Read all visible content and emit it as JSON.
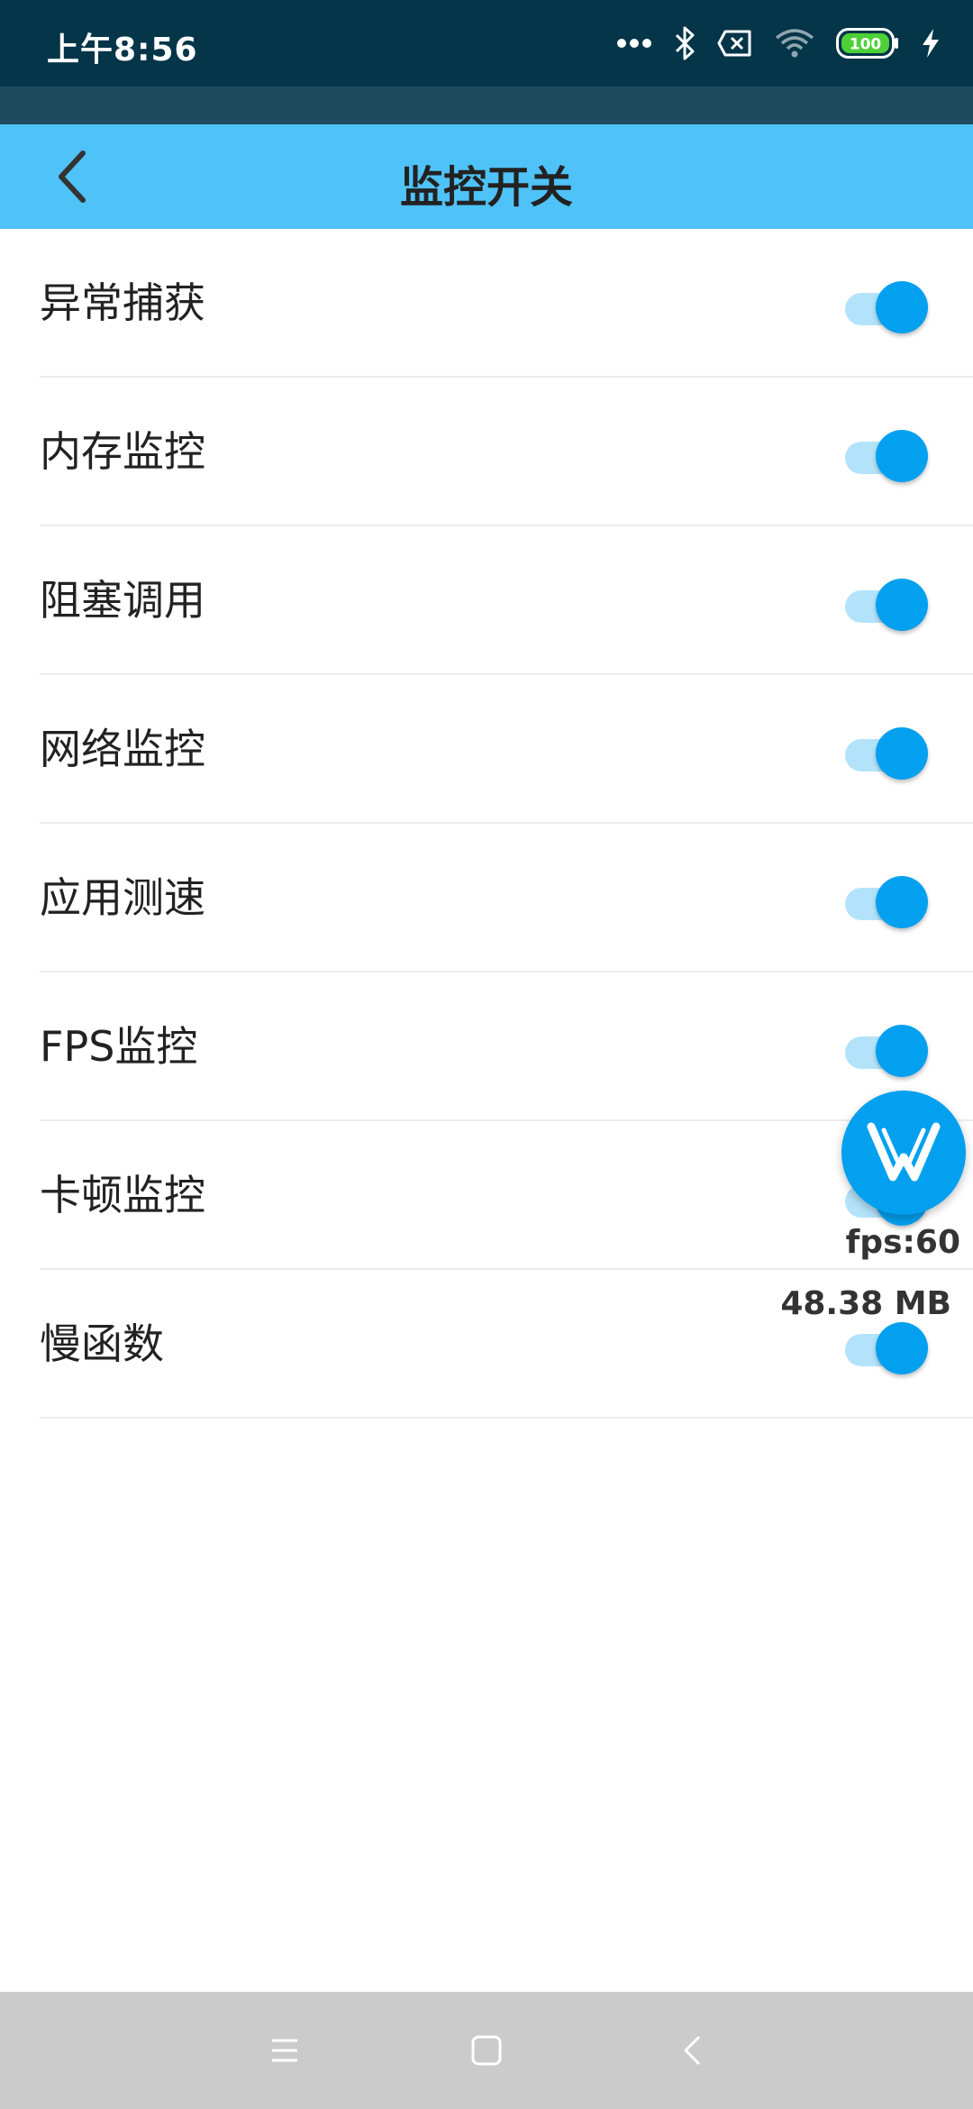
{
  "status_bar": {
    "time": "上午8:56",
    "battery_level": "100",
    "icons": [
      "more-dots-icon",
      "bluetooth-icon",
      "no-sim-icon",
      "wifi-icon",
      "battery-icon",
      "charging-icon"
    ],
    "background_color": "#043548"
  },
  "app_bar": {
    "title": "监控开关",
    "background_color": "#4fc2f7",
    "back_icon": "back-arrow-icon"
  },
  "switches": [
    {
      "label": "异常捕获",
      "enabled": true
    },
    {
      "label": "内存监控",
      "enabled": true
    },
    {
      "label": "阻塞调用",
      "enabled": true
    },
    {
      "label": "网络监控",
      "enabled": true
    },
    {
      "label": "应用测速",
      "enabled": true
    },
    {
      "label": "FPS监控",
      "enabled": true
    },
    {
      "label": "卡顿监控",
      "enabled": true
    },
    {
      "label": "慢函数",
      "enabled": true
    }
  ],
  "toggle_colors": {
    "thumb_on": "#03a0f0",
    "track_on": "#b3e3fb"
  },
  "monitor_widget": {
    "icon": "monitor-logo-icon",
    "fps_text": "fps:60",
    "memory_text": "48.38 MB"
  },
  "nav_bar": {
    "buttons": [
      "menu-icon",
      "home-icon",
      "back-icon"
    ]
  }
}
